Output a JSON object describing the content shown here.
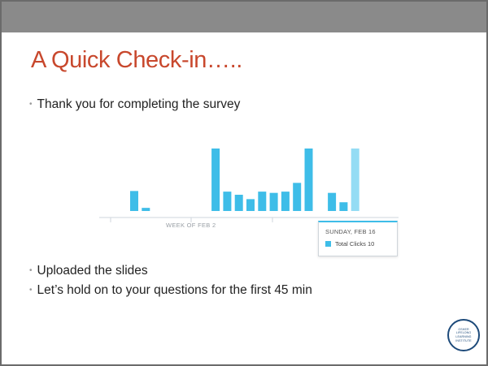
{
  "slide": {
    "title": "A Quick Check-in…..",
    "bullets": [
      "Thank you for completing the survey",
      "Uploaded the slides",
      "Let’s hold on to your questions for the first 45 min"
    ]
  },
  "chart_data": {
    "type": "bar",
    "title": "",
    "xlabel": "",
    "ylabel": "",
    "ylim": [
      0,
      10
    ],
    "grid": false,
    "tick_labels": [
      "WEEK OF FEB 2"
    ],
    "colors": {
      "bar": "#3ebde8",
      "bar_highlight": "#94dcf4",
      "axis": "#cfd6dc",
      "tick_text": "#9aa0a6"
    },
    "bars": [
      {
        "day": 1,
        "value": 3.2
      },
      {
        "day": 2,
        "value": 0.5
      },
      {
        "day": 8,
        "value": 10
      },
      {
        "day": 9,
        "value": 3.1
      },
      {
        "day": 10,
        "value": 2.6
      },
      {
        "day": 11,
        "value": 1.9
      },
      {
        "day": 12,
        "value": 3.1
      },
      {
        "day": 13,
        "value": 2.9
      },
      {
        "day": 14,
        "value": 3.1
      },
      {
        "day": 15,
        "value": 4.5
      },
      {
        "day": 16,
        "value": 10
      },
      {
        "day": 18,
        "value": 2.9
      },
      {
        "day": 19,
        "value": 1.4
      },
      {
        "day": 20,
        "value": 10,
        "highlighted": true
      }
    ],
    "tooltip": {
      "date": "SUNDAY, FEB 16",
      "series": "Total Clicks",
      "value": 10,
      "label": "Total Clicks 10"
    }
  },
  "logo": {
    "text": "OSHER\nLIFELONG\nLEARNING\nINSTITUTE",
    "color": "#1d4a7a"
  },
  "colors": {
    "title": "#c8482d",
    "top_bar": "#8a8a8a",
    "border": "#6b6b6b"
  }
}
